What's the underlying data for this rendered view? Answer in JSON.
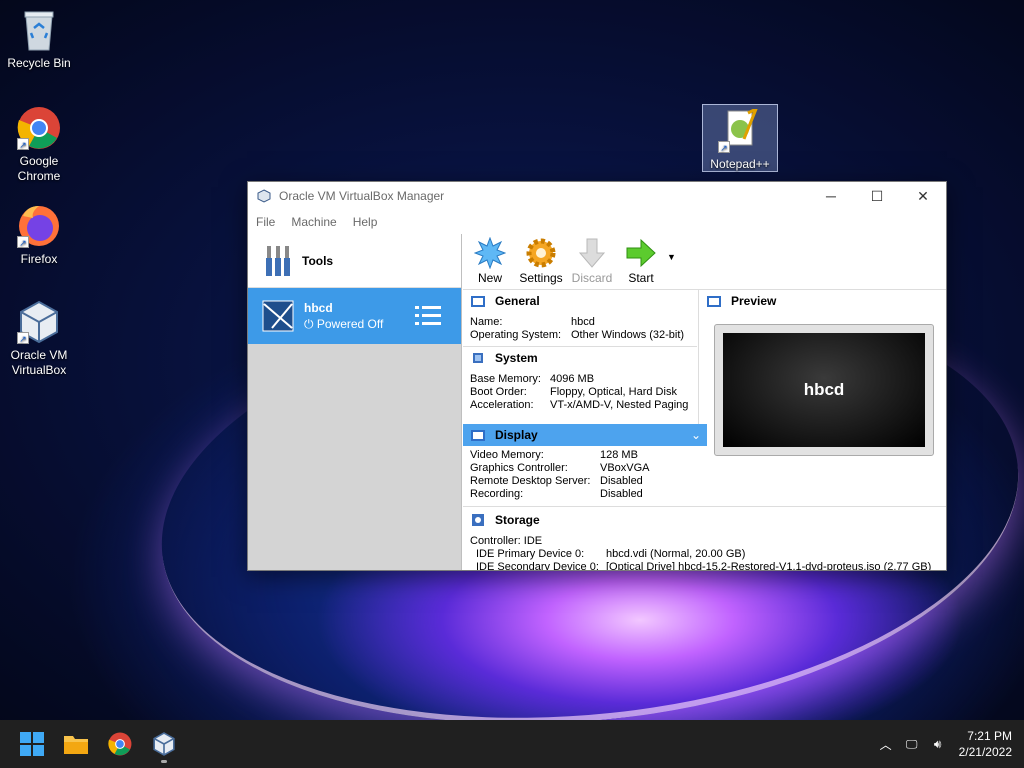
{
  "desktop": {
    "icons": [
      {
        "label": "Recycle Bin"
      },
      {
        "label": "Google Chrome"
      },
      {
        "label": "Firefox"
      },
      {
        "label": "Oracle VM VirtualBox"
      },
      {
        "label": "Notepad++"
      }
    ]
  },
  "window": {
    "title": "Oracle VM VirtualBox Manager",
    "menu": [
      "File",
      "Machine",
      "Help"
    ],
    "tools_label": "Tools",
    "vm": {
      "name": "hbcd",
      "state": "Powered Off"
    },
    "toolbar": [
      {
        "label": "New",
        "enabled": true
      },
      {
        "label": "Settings",
        "enabled": true
      },
      {
        "label": "Discard",
        "enabled": false
      },
      {
        "label": "Start",
        "enabled": true
      }
    ],
    "sections": {
      "general": {
        "title": "General",
        "rows": [
          {
            "k": "Name:",
            "v": "hbcd"
          },
          {
            "k": "Operating System:",
            "v": "Other Windows (32-bit)"
          }
        ]
      },
      "system": {
        "title": "System",
        "rows": [
          {
            "k": "Base Memory:",
            "v": "4096 MB"
          },
          {
            "k": "Boot Order:",
            "v": "Floppy, Optical, Hard Disk"
          },
          {
            "k": "Acceleration:",
            "v": "VT-x/AMD-V, Nested Paging"
          }
        ]
      },
      "display": {
        "title": "Display",
        "rows": [
          {
            "k": "Video Memory:",
            "v": "128 MB"
          },
          {
            "k": "Graphics Controller:",
            "v": "VBoxVGA"
          },
          {
            "k": "Remote Desktop Server:",
            "v": "Disabled"
          },
          {
            "k": "Recording:",
            "v": "Disabled"
          }
        ]
      },
      "storage": {
        "title": "Storage",
        "controller": "Controller: IDE",
        "rows": [
          {
            "k": "IDE Primary Device 0:",
            "v": "hbcd.vdi (Normal, 20.00 GB)"
          },
          {
            "k": "IDE Secondary Device 0:",
            "v": "[Optical Drive] hbcd-15.2-Restored-V1.1-dvd-proteus.iso (2.77 GB)"
          }
        ]
      },
      "preview": {
        "title": "Preview",
        "screen_text": "hbcd"
      }
    }
  },
  "taskbar": {
    "time": "7:21 PM",
    "date": "2/21/2022"
  }
}
